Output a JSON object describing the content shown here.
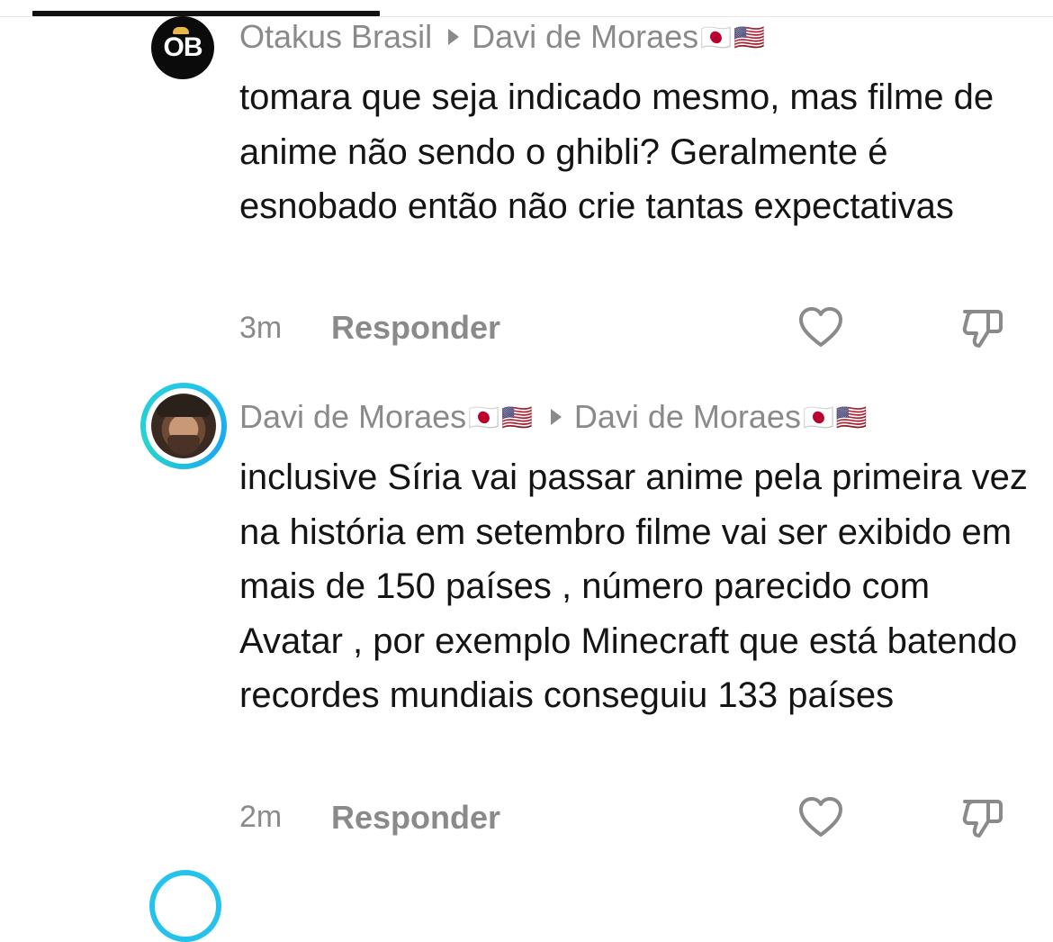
{
  "comments": [
    {
      "author": "Otakus Brasil",
      "author_flags": "",
      "reply_to": "Davi de Moraes",
      "reply_to_flags": "🇯🇵🇺🇸",
      "avatar_text": "OB",
      "text": "tomara que seja indicado mesmo, mas filme de anime não sendo o ghibli? Geralmente é esnobado então não crie tantas expectativas",
      "time": "3m",
      "reply_label": "Responder"
    },
    {
      "author": "Davi de Moraes",
      "author_flags": "🇯🇵🇺🇸",
      "reply_to": "Davi de Moraes",
      "reply_to_flags": "🇯🇵🇺🇸",
      "text": "inclusive Síria vai passar anime pela primeira vez na história em setembro filme vai ser exibido em mais de 150 países , número parecido com Avatar , por exemplo Minecraft que está batendo recordes mundiais conseguiu 133 países",
      "time": "2m",
      "reply_label": "Responder"
    }
  ],
  "icons": {
    "like": "heart-icon",
    "dislike": "thumbs-down-icon",
    "reply_arrow": "triangle-right-icon"
  },
  "colors": {
    "ring_gradient": "#25c8e6",
    "muted_text": "#8a8a8a",
    "body_text": "#141414"
  }
}
